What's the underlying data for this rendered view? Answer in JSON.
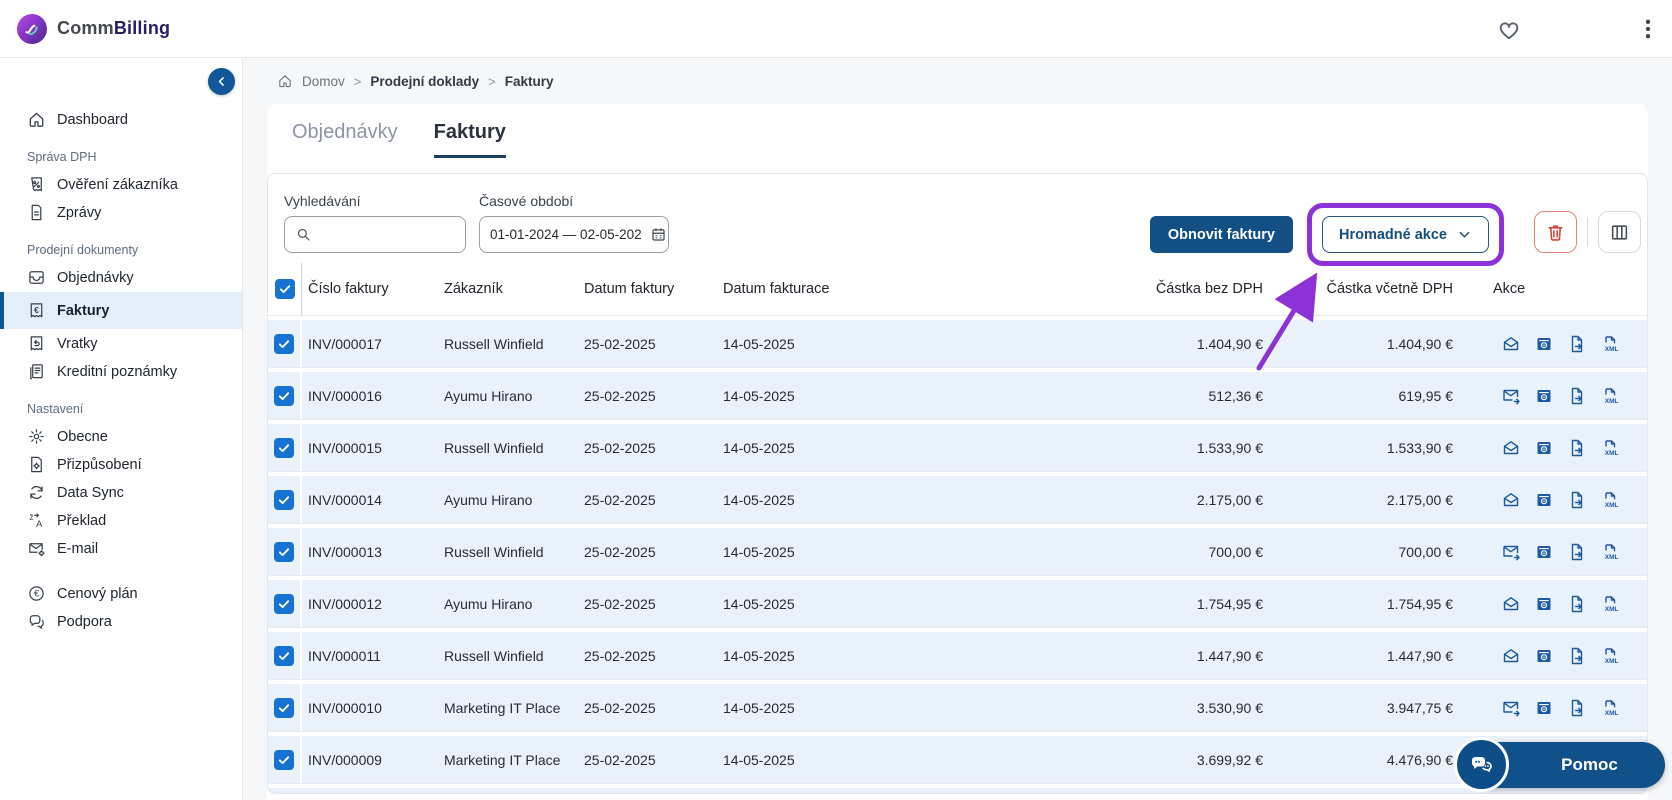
{
  "app": {
    "brand_prefix": "Comm",
    "brand_suffix": "Billing"
  },
  "topbar": {
    "icons": [
      "heart",
      "kebab-menu"
    ]
  },
  "sidebar": {
    "sections": [
      {
        "header": null,
        "items": [
          {
            "label": "Dashboard",
            "icon": "home",
            "active": false
          }
        ]
      },
      {
        "header": "Správa DPH",
        "items": [
          {
            "label": "Ověření zákazníka",
            "icon": "receipt-percent",
            "active": false
          },
          {
            "label": "Zprávy",
            "icon": "document",
            "active": false
          }
        ]
      },
      {
        "header": "Prodejní dokumenty",
        "items": [
          {
            "label": "Objednávky",
            "icon": "orders",
            "active": false
          },
          {
            "label": "Faktury",
            "icon": "invoice",
            "active": true
          },
          {
            "label": "Vratky",
            "icon": "returns",
            "active": false
          },
          {
            "label": "Kreditní poznámky",
            "icon": "credit-note",
            "active": false
          }
        ]
      },
      {
        "header": "Nastavení",
        "items": [
          {
            "label": "Obecne",
            "icon": "gear",
            "active": false
          },
          {
            "label": "Přizpůsobení",
            "icon": "customize",
            "active": false
          },
          {
            "label": "Data Sync",
            "icon": "sync",
            "active": false
          },
          {
            "label": "Překlad",
            "icon": "translate",
            "active": false
          },
          {
            "label": "E-mail",
            "icon": "email-settings",
            "active": false
          }
        ]
      },
      {
        "header": null,
        "items": [
          {
            "label": "Cenový plán",
            "icon": "euro-circle",
            "active": false
          },
          {
            "label": "Podpora",
            "icon": "support",
            "active": false
          }
        ]
      }
    ]
  },
  "breadcrumb": {
    "items": [
      {
        "label": "Domov"
      },
      {
        "label": "Prodejní doklady"
      },
      {
        "label": "Faktury"
      }
    ]
  },
  "tabs": [
    {
      "label": "Objednávky",
      "active": false
    },
    {
      "label": "Faktury",
      "active": true
    }
  ],
  "filters": {
    "search": {
      "label": "Vyhledávání",
      "value": ""
    },
    "period": {
      "label": "Časové období",
      "value": "01-01-2024 — 02-05-202"
    }
  },
  "toolbar": {
    "refresh_label": "Obnovit faktury",
    "bulk_label": "Hromadné akce",
    "icons": [
      "trash",
      "columns"
    ]
  },
  "table": {
    "select_all_checked": true,
    "columns": [
      "Číslo faktury",
      "Zákazník",
      "Datum faktury",
      "Datum fakturace",
      "Částka bez DPH",
      "Částka včetně DPH",
      "Akce"
    ],
    "rows": [
      {
        "number": "INV/000017",
        "customer": "Russell Winfield",
        "invoice_date": "25-02-2025",
        "billing_date": "14-05-2025",
        "amount_excl": "1.404,90 €",
        "amount_incl": "1.404,90 €",
        "checked": true,
        "email": "open"
      },
      {
        "number": "INV/000016",
        "customer": "Ayumu Hirano",
        "invoice_date": "25-02-2025",
        "billing_date": "14-05-2025",
        "amount_excl": "512,36 €",
        "amount_incl": "619,95 €",
        "checked": true,
        "email": "send"
      },
      {
        "number": "INV/000015",
        "customer": "Russell Winfield",
        "invoice_date": "25-02-2025",
        "billing_date": "14-05-2025",
        "amount_excl": "1.533,90 €",
        "amount_incl": "1.533,90 €",
        "checked": true,
        "email": "open"
      },
      {
        "number": "INV/000014",
        "customer": "Ayumu Hirano",
        "invoice_date": "25-02-2025",
        "billing_date": "14-05-2025",
        "amount_excl": "2.175,00 €",
        "amount_incl": "2.175,00 €",
        "checked": true,
        "email": "open"
      },
      {
        "number": "INV/000013",
        "customer": "Russell Winfield",
        "invoice_date": "25-02-2025",
        "billing_date": "14-05-2025",
        "amount_excl": "700,00 €",
        "amount_incl": "700,00 €",
        "checked": true,
        "email": "send"
      },
      {
        "number": "INV/000012",
        "customer": "Ayumu Hirano",
        "invoice_date": "25-02-2025",
        "billing_date": "14-05-2025",
        "amount_excl": "1.754,95 €",
        "amount_incl": "1.754,95 €",
        "checked": true,
        "email": "open"
      },
      {
        "number": "INV/000011",
        "customer": "Russell Winfield",
        "invoice_date": "25-02-2025",
        "billing_date": "14-05-2025",
        "amount_excl": "1.447,90 €",
        "amount_incl": "1.447,90 €",
        "checked": true,
        "email": "open"
      },
      {
        "number": "INV/000010",
        "customer": "Marketing IT Place",
        "invoice_date": "25-02-2025",
        "billing_date": "14-05-2025",
        "amount_excl": "3.530,90 €",
        "amount_incl": "3.947,75 €",
        "checked": true,
        "email": "send"
      },
      {
        "number": "INV/000009",
        "customer": "Marketing IT Place",
        "invoice_date": "25-02-2025",
        "billing_date": "14-05-2025",
        "amount_excl": "3.699,92 €",
        "amount_incl": "4.476,90 €",
        "checked": true,
        "email": "open"
      }
    ]
  },
  "help_button": {
    "label": "Pomoc"
  },
  "annotation": {
    "highlight_color": "#8d32d8",
    "target": "bulk-actions-button"
  }
}
